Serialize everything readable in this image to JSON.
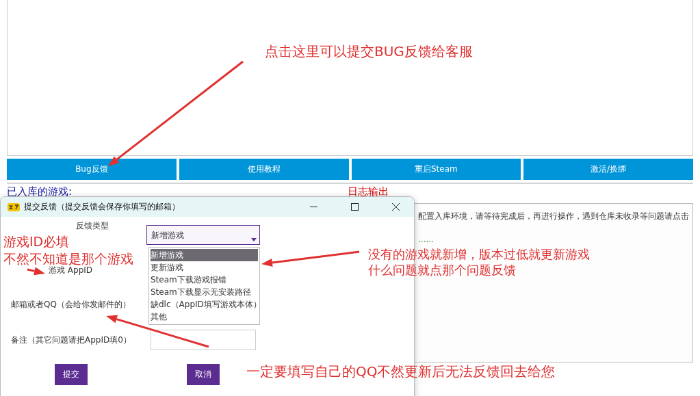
{
  "toolbar_buttons": [
    "Bug反馈",
    "使用教程",
    "重启Steam",
    "激活/换绑"
  ],
  "games_label": "已入库的游戏:",
  "log": {
    "label": "日志输出",
    "lines": [
      {
        "text": "配置入库环境，请等待完成后，再进行操作，遇到仓库未收录等问题请点击",
        "kind": "info"
      },
      {
        "text": "......",
        "kind": "progress"
      }
    ]
  },
  "dialog": {
    "title": "提交反馈（提交反馈会保存你填写的邮箱）",
    "type_label": "反馈类型",
    "type_value": "新增游戏",
    "options": [
      {
        "label": "新增游戏",
        "selected": true
      },
      {
        "label": "更新游戏",
        "selected": false
      },
      {
        "label": "Steam下载游戏报错",
        "selected": false
      },
      {
        "label": "Steam下载显示无安装路径",
        "selected": false
      },
      {
        "label": "缺dlc（AppID填写游戏本体）",
        "selected": false
      },
      {
        "label": "其他",
        "selected": false
      }
    ],
    "appid_label": "游戏 AppID",
    "email_label": "邮箱或者QQ（会给你发邮件的）",
    "note_label": "备注（其它问题请把AppID填0）",
    "submit": "提交",
    "cancel": "取消"
  },
  "annotations": [
    {
      "lines": [
        "点击这里可以提交BUG反馈给客服"
      ]
    },
    {
      "lines": [
        "游戏ID必填",
        "不然不知道是那个游戏"
      ]
    },
    {
      "lines": [
        "没有的游戏就新增，版本过低就更新游戏",
        "什么问题就点那个问题反馈"
      ]
    },
    {
      "lines": [
        "一定要填写自己的QQ不然更新后无法反馈回去给您"
      ]
    }
  ]
}
